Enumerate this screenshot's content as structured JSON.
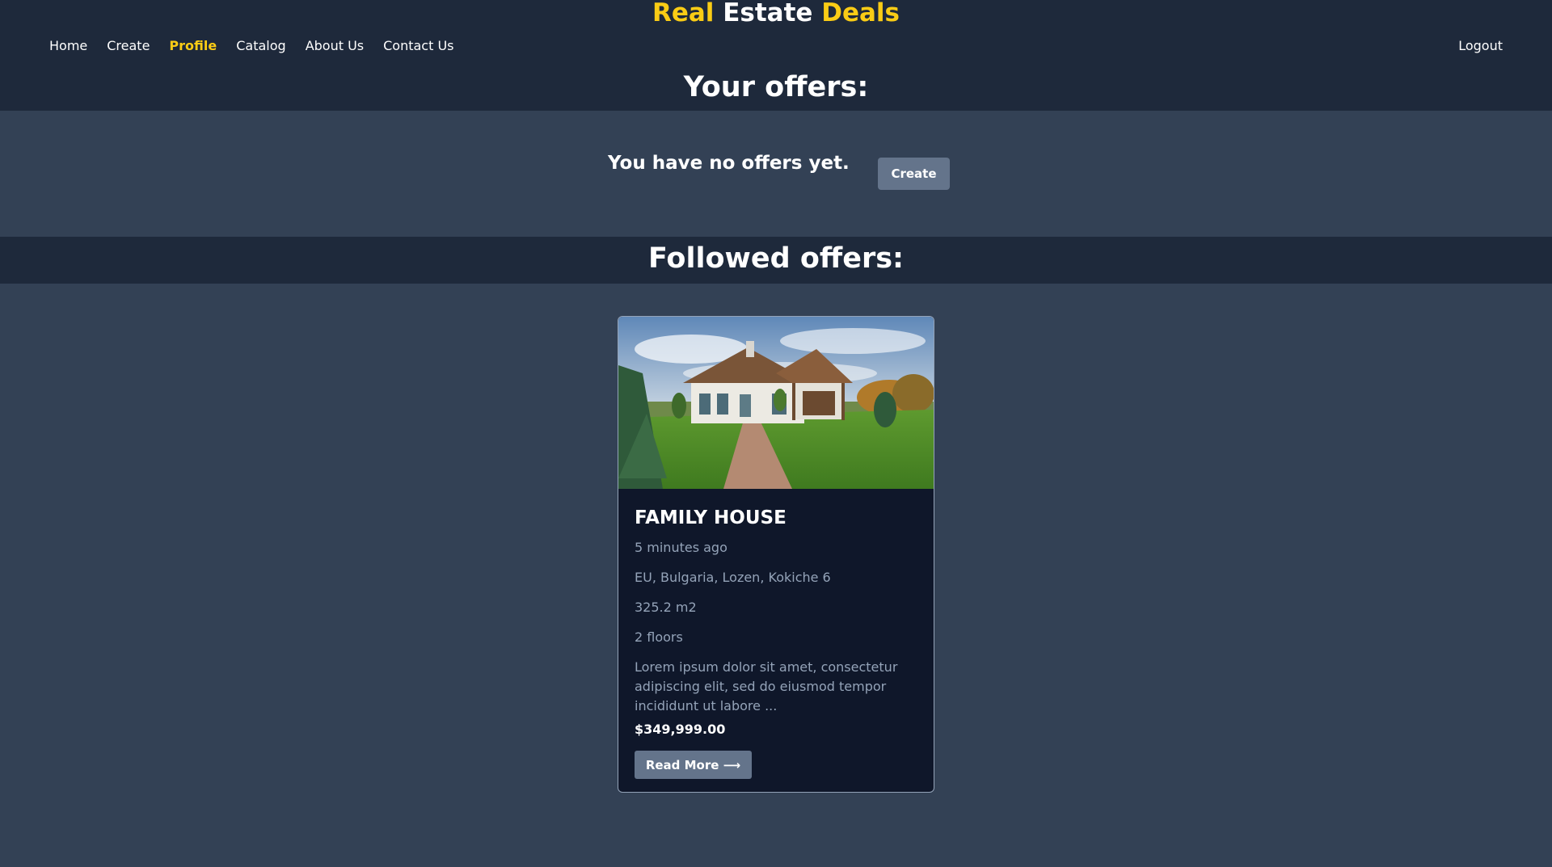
{
  "brand": {
    "word1": "Real",
    "word2": "Estate",
    "word3": "Deals",
    "accent_color": "#facc15"
  },
  "nav": {
    "items": [
      {
        "label": "Home",
        "active": false
      },
      {
        "label": "Create",
        "active": false
      },
      {
        "label": "Profile",
        "active": true
      },
      {
        "label": "Catalog",
        "active": false
      },
      {
        "label": "About Us",
        "active": false
      },
      {
        "label": "Contact Us",
        "active": false
      }
    ],
    "logout_label": "Logout"
  },
  "your_offers": {
    "title": "Your offers:",
    "empty_message": "You have no offers yet.",
    "create_label": "Create"
  },
  "followed_offers": {
    "title": "Followed offers:",
    "cards": [
      {
        "image": "house-photo",
        "title": "FAMILY HOUSE",
        "time": "5 minutes ago",
        "location": "EU, Bulgaria, Lozen, Kokiche 6",
        "area": "325.2 m2",
        "floors": "2 floors",
        "description": "Lorem ipsum dolor sit amet, consectetur adipiscing elit, sed do eiusmod tempor incididunt ut labore ...",
        "price": "$349,999.00",
        "read_more_label": "Read More ⟶"
      }
    ]
  },
  "colors": {
    "header_bg": "#1e293b",
    "page_bg": "#334155",
    "card_bg": "#0f172a",
    "button_bg": "#64748b"
  }
}
